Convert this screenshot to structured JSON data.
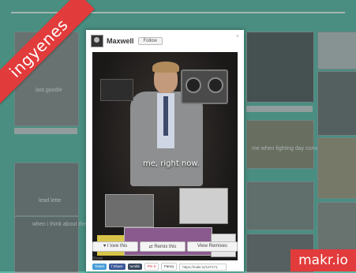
{
  "ribbon": {
    "label": "ingyenes"
  },
  "brand": {
    "label": "makr.io"
  },
  "background": {
    "left_texts": [
      "last goodie",
      "lead lette",
      "when i think about the"
    ],
    "right_texts": [
      "me when fighting day come"
    ]
  },
  "modal": {
    "close_icon": "×",
    "user": {
      "name": "Maxwell",
      "follow_label": "Follow"
    },
    "caption": "me, right now.",
    "actions": {
      "love_label": "♥ I love this",
      "remix_label": "⇄ Remix this",
      "view_remixes_label": "View Remixes"
    },
    "share": {
      "label": "Share",
      "tweet_label": "Tweet",
      "facebook_label": "f Share",
      "tumblr_label": "tumblr",
      "pin_label": "Pin it",
      "fancy_label": "Fancy",
      "url": "https://makr.io/137171"
    }
  },
  "colors": {
    "page_bg": "#5bbaa6",
    "accent": "#e23b3b"
  }
}
